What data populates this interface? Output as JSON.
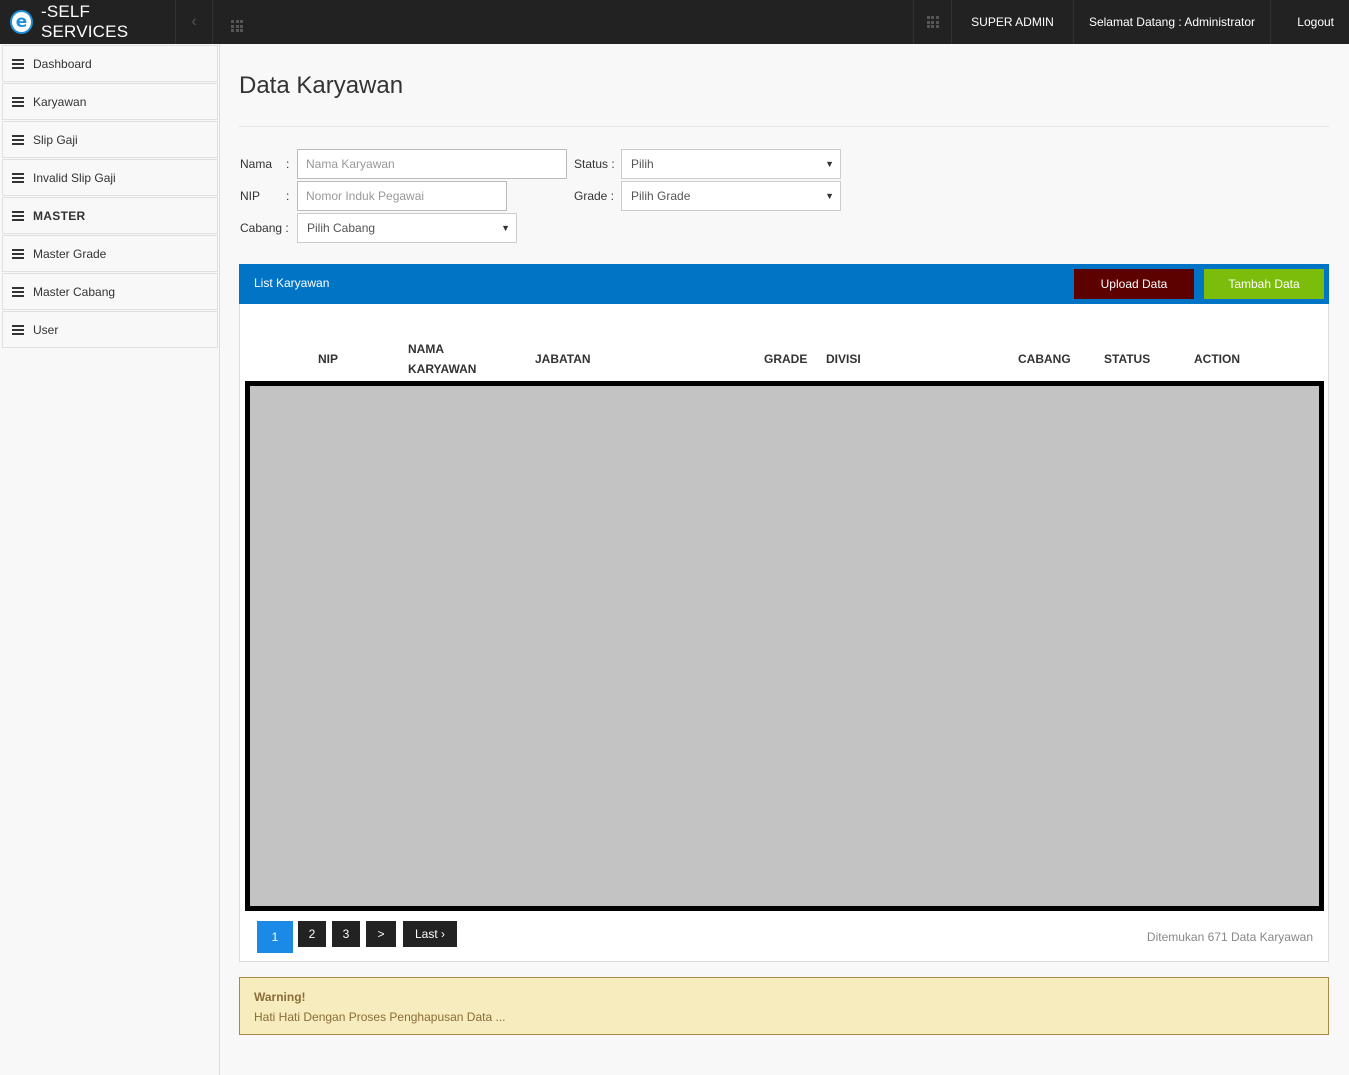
{
  "topbar": {
    "brand_logo": "e",
    "brand_text": "-SELF SERVICES",
    "collapse_icon": "‹",
    "role": "SUPER ADMIN",
    "welcome": "Selamat Datang : Administrator",
    "logout": "Logout"
  },
  "sidebar": {
    "items": [
      {
        "label": "Dashboard",
        "icon": "list-icon"
      },
      {
        "label": "Karyawan",
        "icon": "list-icon"
      },
      {
        "label": "Slip Gaji",
        "icon": "list-icon"
      },
      {
        "label": "Invalid Slip Gaji",
        "icon": "list-icon"
      },
      {
        "label": "MASTER",
        "icon": "list-icon"
      },
      {
        "label": "Master Grade",
        "icon": "list-icon"
      },
      {
        "label": "Master Cabang",
        "icon": "list-icon"
      },
      {
        "label": "User",
        "icon": "list-icon"
      }
    ]
  },
  "main": {
    "title": "Data Karyawan",
    "filters": {
      "nama_label": "Nama",
      "nama_placeholder": "Nama Karyawan",
      "nip_label": "NIP",
      "nip_placeholder": "Nomor Induk Pegawai",
      "cabang_label": "Cabang :",
      "cabang_value": "Pilih Cabang",
      "status_label": "Status :",
      "status_value": "Pilih",
      "grade_label": "Grade :",
      "grade_value": "Pilih Grade",
      "colon": ":",
      "caret": "▼"
    },
    "panel": {
      "title": "List Karyawan",
      "upload_label": "Upload Data",
      "add_label": "Tambah Data",
      "headers": [
        "NIP",
        "NAMA",
        "KARYAWAN",
        "JABATAN",
        "GRADE",
        "DIVISI",
        "CABANG",
        "STATUS",
        "ACTION"
      ],
      "pages": [
        "1",
        "2",
        "3",
        ">",
        "Last ›"
      ],
      "current_page": "1",
      "found_text": "Ditemukan 671 Data Karyawan"
    },
    "warning": {
      "title": "Warning!",
      "text": "Hati Hati Dengan Proses Penghapusan Data ..."
    }
  },
  "colors": {
    "topbar": "#222222",
    "panel_header": "#0274c6",
    "upload_button": "#5c0000",
    "add_button": "#7cbc0a",
    "active_page": "#1a8ae6",
    "warning_bg": "#f7ecbd"
  }
}
